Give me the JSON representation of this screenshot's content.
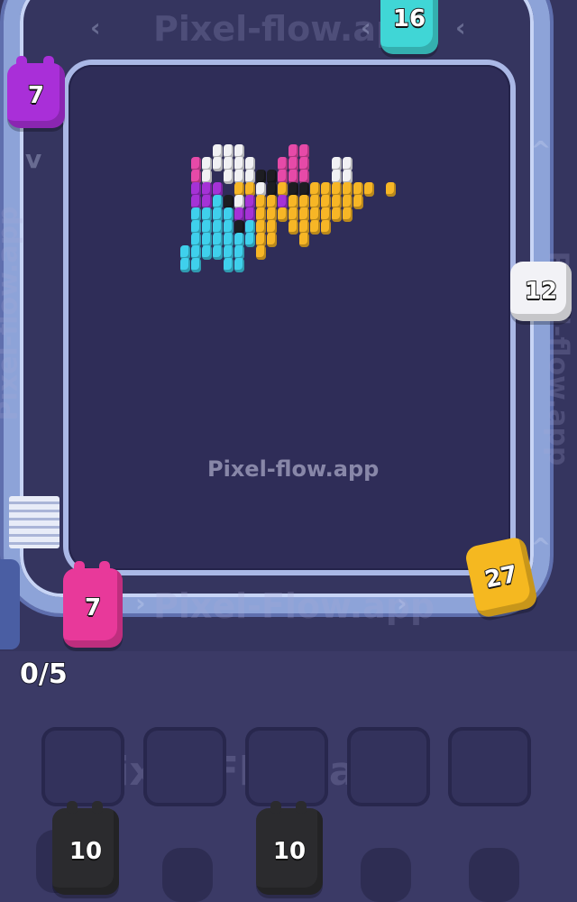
{
  "watermarks": {
    "center": "Pixel-flow.app",
    "track_bottom": "Pixel-Flow.app",
    "track_top": "Pixel-flow.app",
    "slots_area": "Pixel-Flow.app",
    "left_rail": "Pixel-flow.app",
    "right_rail": "Pixel-flow.app"
  },
  "progress": {
    "label": "0/5",
    "filled": 0,
    "total": 5
  },
  "track_piggies": [
    {
      "label": "16",
      "color": "#40d6d6"
    },
    {
      "label": "7",
      "color": "#a92fd8"
    },
    {
      "label": "12",
      "color": "#f2f2f6"
    },
    {
      "label": "27",
      "color": "#f5b820"
    },
    {
      "label": "7",
      "color": "#e8399a"
    }
  ],
  "queue_piggies": [
    {
      "label": "10",
      "color": "#2b2b2e"
    },
    {
      "label": "10",
      "color": "#2b2b2e"
    }
  ],
  "slots_count": 5,
  "pixel_colors": {
    "white": "#f1f1f4",
    "magenta": "#e64aa8",
    "purple": "#a532d6",
    "cyan": "#3fd0ec",
    "orange": "#f7b626",
    "black": "#1d1d22"
  }
}
